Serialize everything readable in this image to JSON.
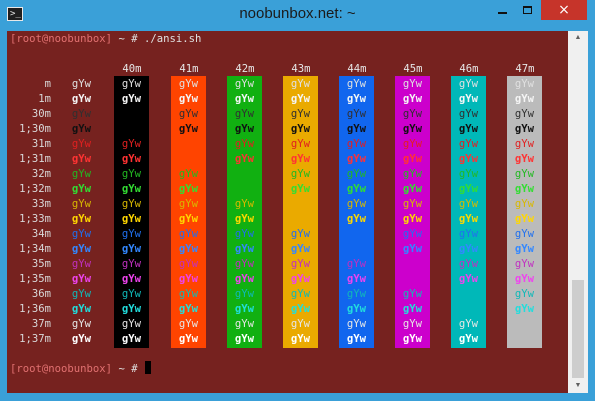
{
  "window": {
    "title": "noobunbox.net: ~",
    "app_icon_glyph": ">_",
    "controls": {
      "minimize": "minimize",
      "maximize": "maximize",
      "close": "×"
    }
  },
  "terminal": {
    "background_color": "#76221f",
    "prompt1": {
      "user_host": "[root@noobunbox]",
      "tail": " ~ # ",
      "command": "./ansi.sh"
    },
    "prompt2": {
      "user_host": "[root@noobunbox]",
      "tail": " ~ # "
    },
    "sample_text": "gYw",
    "bg_headers": [
      "40m",
      "41m",
      "42m",
      "43m",
      "44m",
      "45m",
      "46m",
      "47m"
    ],
    "bg_colors": [
      "#000000",
      "#ff4400",
      "#11b011",
      "#eaaa00",
      "#1166ee",
      "#cc00cc",
      "#00b8b8",
      "#bbbbbb"
    ],
    "row_labels": [
      "m",
      "1m",
      "30m",
      "1;30m",
      "31m",
      "1;31m",
      "32m",
      "1;32m",
      "33m",
      "1;33m",
      "34m",
      "1;34m",
      "35m",
      "1;35m",
      "36m",
      "1;36m",
      "37m",
      "1;37m"
    ],
    "row_fg_colors": [
      "#e0e0e0",
      "#f5f5f5",
      "#303030",
      "#111111",
      "#e02020",
      "#ff3333",
      "#22b822",
      "#33dd33",
      "#d8b800",
      "#ffd700",
      "#2070ee",
      "#3388ff",
      "#c030c0",
      "#ee44ee",
      "#10b8b8",
      "#22dddd",
      "#e6e6e6",
      "#ffffff"
    ]
  },
  "scrollbar": {
    "up_arrow": "▲",
    "down_arrow": "▼"
  }
}
